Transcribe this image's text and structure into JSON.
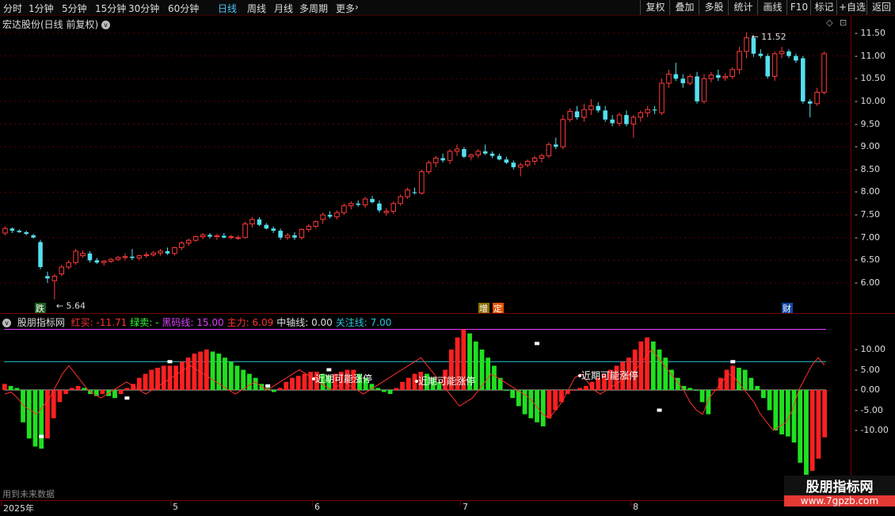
{
  "toolbar": {
    "timeframes": [
      "分时",
      "1分钟",
      "5分钟",
      "15分钟",
      "30分钟",
      "60分钟",
      "日线",
      "周线",
      "月线",
      "多周期",
      "更多"
    ],
    "active_index": 6,
    "right_buttons": [
      "复权",
      "叠加",
      "多股",
      "统计",
      "画线",
      "F10",
      "标记",
      "+自选",
      "返回"
    ]
  },
  "stock": {
    "title": "宏达股份(日线 前复权)",
    "high_label": "11.52",
    "low_label": "5.64",
    "events": [
      {
        "text": "跌",
        "bg": "#1b5e20",
        "color": "#fff"
      },
      {
        "text": "增",
        "bg": "#8d6e00",
        "color": "#fff"
      },
      {
        "text": "定",
        "bg": "#e65100",
        "color": "#fff"
      },
      {
        "text": "财",
        "bg": "#0d47a1",
        "color": "#fff"
      }
    ]
  },
  "price_axis": [
    "11.50",
    "11.00",
    "10.50",
    "10.00",
    "9.50",
    "9.00",
    "8.50",
    "8.00",
    "7.50",
    "7.00",
    "6.50",
    "6.00"
  ],
  "indicator": {
    "name": "股朋指标网",
    "items": [
      {
        "label": "红买: -11.71",
        "color": "#ff3333"
      },
      {
        "label": "绿卖: -",
        "color": "#33ff33"
      },
      {
        "label": "黑码线: 15.00",
        "color": "#e040fb"
      },
      {
        "label": "主力: 6.09",
        "color": "#ff3333"
      },
      {
        "label": "中轴线: 0.00",
        "color": "#dddddd"
      },
      {
        "label": "关注线: 7.00",
        "color": "#26c6da"
      }
    ],
    "annotation": "近期可能涨停",
    "axis": [
      "10.00",
      "5.00",
      "0.00",
      "-5.00",
      "-10.00"
    ]
  },
  "time_axis": [
    "2025年",
    "5",
    "6",
    "7",
    "8"
  ],
  "future_note": "用到未来数据",
  "watermark": {
    "line1": "股朋指标网",
    "line2": "www.7gpzb.com"
  },
  "chart_data": {
    "type": "candlestick",
    "title": "宏达股份(日线 前复权)",
    "ylim": [
      5.5,
      11.8
    ],
    "candles": [
      [
        7.1,
        7.25,
        7.05,
        7.2
      ],
      [
        7.2,
        7.22,
        7.1,
        7.15
      ],
      [
        7.15,
        7.18,
        7.1,
        7.12
      ],
      [
        7.12,
        7.15,
        7.05,
        7.08
      ],
      [
        7.05,
        7.08,
        6.98,
        7.0
      ],
      [
        6.9,
        6.95,
        6.3,
        6.35
      ],
      [
        6.15,
        6.25,
        6.0,
        6.1
      ],
      [
        6.05,
        6.2,
        5.64,
        6.15
      ],
      [
        6.2,
        6.4,
        6.15,
        6.35
      ],
      [
        6.35,
        6.5,
        6.3,
        6.45
      ],
      [
        6.45,
        6.75,
        6.4,
        6.7
      ],
      [
        6.6,
        6.72,
        6.55,
        6.65
      ],
      [
        6.65,
        6.7,
        6.45,
        6.5
      ],
      [
        6.5,
        6.55,
        6.42,
        6.45
      ],
      [
        6.45,
        6.5,
        6.38,
        6.48
      ],
      [
        6.48,
        6.55,
        6.44,
        6.52
      ],
      [
        6.52,
        6.6,
        6.48,
        6.56
      ],
      [
        6.56,
        6.65,
        6.5,
        6.58
      ],
      [
        6.58,
        6.75,
        6.5,
        6.55
      ],
      [
        6.55,
        6.62,
        6.5,
        6.6
      ],
      [
        6.6,
        6.68,
        6.55,
        6.62
      ],
      [
        6.62,
        6.7,
        6.58,
        6.66
      ],
      [
        6.66,
        6.75,
        6.6,
        6.7
      ],
      [
        6.7,
        6.78,
        6.62,
        6.65
      ],
      [
        6.65,
        6.8,
        6.6,
        6.78
      ],
      [
        6.78,
        6.92,
        6.72,
        6.88
      ],
      [
        6.88,
        6.98,
        6.82,
        6.94
      ],
      [
        6.94,
        7.05,
        6.9,
        7.02
      ],
      [
        7.02,
        7.1,
        6.96,
        7.06
      ],
      [
        7.06,
        7.1,
        6.98,
        7.02
      ],
      [
        7.02,
        7.08,
        6.95,
        7.04
      ],
      [
        7.04,
        7.1,
        6.98,
        7.0
      ],
      [
        7.0,
        7.06,
        6.96,
        7.02
      ],
      [
        6.98,
        7.05,
        6.95,
        7.0
      ],
      [
        7.0,
        7.35,
        6.98,
        7.3
      ],
      [
        7.3,
        7.45,
        7.22,
        7.4
      ],
      [
        7.4,
        7.45,
        7.25,
        7.28
      ],
      [
        7.28,
        7.32,
        7.18,
        7.2
      ],
      [
        7.2,
        7.25,
        7.1,
        7.15
      ],
      [
        7.15,
        7.2,
        6.95,
        7.0
      ],
      [
        7.0,
        7.1,
        6.95,
        7.05
      ],
      [
        7.05,
        7.12,
        6.95,
        7.0
      ],
      [
        7.0,
        7.2,
        6.95,
        7.18
      ],
      [
        7.18,
        7.3,
        7.12,
        7.25
      ],
      [
        7.25,
        7.38,
        7.2,
        7.35
      ],
      [
        7.4,
        7.55,
        7.3,
        7.5
      ],
      [
        7.5,
        7.58,
        7.42,
        7.46
      ],
      [
        7.46,
        7.6,
        7.4,
        7.55
      ],
      [
        7.55,
        7.75,
        7.5,
        7.7
      ],
      [
        7.7,
        7.8,
        7.62,
        7.75
      ],
      [
        7.75,
        7.82,
        7.68,
        7.72
      ],
      [
        7.72,
        7.9,
        7.65,
        7.85
      ],
      [
        7.85,
        7.92,
        7.75,
        7.78
      ],
      [
        7.75,
        7.82,
        7.55,
        7.6
      ],
      [
        7.55,
        7.65,
        7.48,
        7.58
      ],
      [
        7.58,
        7.8,
        7.52,
        7.75
      ],
      [
        7.75,
        7.95,
        7.7,
        7.9
      ],
      [
        7.9,
        8.1,
        7.85,
        8.05
      ],
      [
        8.0,
        8.1,
        7.95,
        7.98
      ],
      [
        7.98,
        8.5,
        7.95,
        8.45
      ],
      [
        8.45,
        8.7,
        8.4,
        8.65
      ],
      [
        8.65,
        8.8,
        8.55,
        8.75
      ],
      [
        8.75,
        8.85,
        8.65,
        8.7
      ],
      [
        8.7,
        8.95,
        8.62,
        8.9
      ],
      [
        8.9,
        9.05,
        8.8,
        8.95
      ],
      [
        8.95,
        9.0,
        8.75,
        8.78
      ],
      [
        8.78,
        8.85,
        8.7,
        8.82
      ],
      [
        8.82,
        8.95,
        8.75,
        8.9
      ],
      [
        8.9,
        9.05,
        8.82,
        8.85
      ],
      [
        8.85,
        8.9,
        8.75,
        8.8
      ],
      [
        8.8,
        8.85,
        8.7,
        8.72
      ],
      [
        8.72,
        8.78,
        8.62,
        8.65
      ],
      [
        8.65,
        8.7,
        8.5,
        8.55
      ],
      [
        8.55,
        8.65,
        8.35,
        8.6
      ],
      [
        8.6,
        8.72,
        8.55,
        8.68
      ],
      [
        8.68,
        8.8,
        8.6,
        8.75
      ],
      [
        8.75,
        8.85,
        8.65,
        8.8
      ],
      [
        8.8,
        9.1,
        8.75,
        9.05
      ],
      [
        9.05,
        9.2,
        8.95,
        9.0
      ],
      [
        9.0,
        9.7,
        8.95,
        9.6
      ],
      [
        9.6,
        9.85,
        9.55,
        9.78
      ],
      [
        9.78,
        9.9,
        9.6,
        9.65
      ],
      [
        9.65,
        9.95,
        9.55,
        9.82
      ],
      [
        9.82,
        10.05,
        9.7,
        9.9
      ],
      [
        9.9,
        9.98,
        9.75,
        9.8
      ],
      [
        9.8,
        9.9,
        9.55,
        9.6
      ],
      [
        9.6,
        9.7,
        9.45,
        9.52
      ],
      [
        9.52,
        9.75,
        9.45,
        9.7
      ],
      [
        9.7,
        9.8,
        9.45,
        9.5
      ],
      [
        9.5,
        9.7,
        9.2,
        9.65
      ],
      [
        9.65,
        9.8,
        9.55,
        9.75
      ],
      [
        9.75,
        9.9,
        9.65,
        9.82
      ],
      [
        9.82,
        9.9,
        9.72,
        9.8
      ],
      [
        9.75,
        10.5,
        9.7,
        10.4
      ],
      [
        10.4,
        10.7,
        10.3,
        10.6
      ],
      [
        10.6,
        10.85,
        10.45,
        10.5
      ],
      [
        10.5,
        10.6,
        10.3,
        10.4
      ],
      [
        10.4,
        10.6,
        10.35,
        10.55
      ],
      [
        10.55,
        10.65,
        9.95,
        10.0
      ],
      [
        10.0,
        10.6,
        9.95,
        10.5
      ],
      [
        10.5,
        10.65,
        10.42,
        10.58
      ],
      [
        10.58,
        10.7,
        10.45,
        10.52
      ],
      [
        10.52,
        10.62,
        10.45,
        10.55
      ],
      [
        10.55,
        10.75,
        10.5,
        10.7
      ],
      [
        10.7,
        11.2,
        10.6,
        11.1
      ],
      [
        11.1,
        11.52,
        10.95,
        11.4
      ],
      [
        11.4,
        11.45,
        10.98,
        11.05
      ],
      [
        11.05,
        11.15,
        10.95,
        11.0
      ],
      [
        11.0,
        11.05,
        10.5,
        10.55
      ],
      [
        10.55,
        11.1,
        10.45,
        11.05
      ],
      [
        11.05,
        11.2,
        10.95,
        11.1
      ],
      [
        11.1,
        11.15,
        10.95,
        11.0
      ],
      [
        11.0,
        11.05,
        10.85,
        10.9
      ],
      [
        10.95,
        11.0,
        9.95,
        10.0
      ],
      [
        10.0,
        10.05,
        9.65,
        9.95
      ],
      [
        9.95,
        10.3,
        9.9,
        10.2
      ],
      [
        10.2,
        11.1,
        10.15,
        11.05
      ]
    ],
    "indicator_series": [
      {
        "name": "红买/绿卖",
        "values": [
          1.5,
          1,
          0.5,
          -8,
          -12,
          -14,
          -14.5,
          -12,
          -7,
          -3,
          -1,
          0.5,
          1,
          0.5,
          -1,
          -1.5,
          -1,
          -1.5,
          -2,
          -1,
          0.5,
          1.5,
          3,
          4,
          5,
          5.5,
          6,
          6,
          6,
          7,
          8,
          9,
          9.5,
          10,
          9.5,
          9,
          8,
          7,
          6,
          5,
          4,
          3,
          1.5,
          0.5,
          -0.5,
          0.5,
          2,
          3,
          3.5,
          4,
          4.5,
          4.5,
          4,
          3.5,
          4,
          4.5,
          5,
          5,
          4,
          3,
          1.5,
          0.5,
          -0.5,
          -1,
          0.5,
          2,
          3,
          4,
          4.5,
          4,
          3,
          2,
          5,
          10,
          13,
          15,
          14,
          12,
          10,
          8,
          6,
          3,
          0,
          -2,
          -4,
          -6,
          -7,
          -8,
          -9,
          -7,
          -5,
          -3,
          -1,
          0,
          0.5,
          1,
          2,
          3,
          4,
          5,
          6,
          7,
          8,
          10,
          12,
          13,
          12,
          10,
          8,
          5,
          3,
          1,
          0.5,
          0,
          -3,
          -6,
          0,
          3,
          5,
          6,
          5.5,
          5,
          3,
          1,
          -2,
          -5,
          -10,
          -11,
          -11.5,
          -13,
          -18,
          -21,
          -20,
          -17,
          -11.7
        ]
      },
      {
        "name": "主力",
        "values": [
          -1,
          -0.5,
          -2,
          -4,
          -5,
          -6,
          -4,
          -2,
          1,
          4,
          6,
          4,
          2,
          0,
          -1,
          -2,
          -1,
          0,
          1,
          2,
          1,
          0,
          -1,
          0,
          1,
          2,
          3,
          4,
          5,
          6,
          5,
          4,
          3,
          2,
          1,
          0,
          -1,
          0,
          1,
          2,
          1,
          0,
          1,
          2,
          3,
          4,
          5,
          4,
          3,
          2,
          1,
          0,
          1,
          2,
          1,
          0,
          -1,
          0,
          1,
          2,
          3,
          4,
          5,
          6,
          7,
          8,
          6,
          4,
          2,
          0,
          -2,
          -4,
          -3,
          -2,
          0,
          2,
          4,
          3,
          2,
          1,
          0,
          -1,
          -2,
          -4,
          -6,
          -7,
          -5,
          -3,
          0,
          3,
          4,
          2,
          0,
          -1,
          0,
          1,
          2,
          3,
          4,
          6,
          8,
          10,
          8,
          6,
          4,
          2,
          0,
          -3,
          -5,
          -6,
          -2,
          0,
          2,
          4,
          3,
          1,
          -1,
          -3,
          -6,
          -8,
          -10,
          -9,
          -8,
          -5,
          0,
          3,
          6,
          8,
          6.09
        ]
      }
    ],
    "lines": {
      "黑码线": 15.0,
      "关注线": 7.0,
      "中轴线": 0.0
    }
  }
}
